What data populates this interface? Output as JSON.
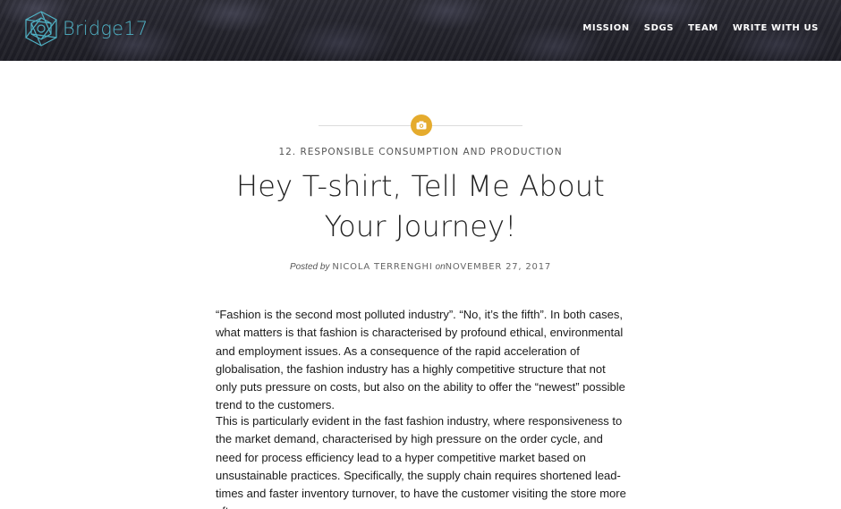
{
  "header": {
    "logo_text": "Bridge17",
    "nav": [
      {
        "label": "MISSION"
      },
      {
        "label": "SDGS"
      },
      {
        "label": "TEAM"
      },
      {
        "label": "WRITE WITH US"
      }
    ]
  },
  "post": {
    "format_icon": "camera-icon",
    "category": "12. RESPONSIBLE CONSUMPTION AND PRODUCTION",
    "title_line1": "Hey T-shirt, Tell Me About",
    "title_line2": "Your Journey!",
    "posted_by_label": "Posted by",
    "author": "NICOLA TERRENGHI",
    "on_label": "on",
    "date": "NOVEMBER 27, 2017",
    "paragraphs": [
      "“Fashion is the second most polluted industry”. “No, it’s the fifth”. In both cases, what matters is that fashion is characterised by profound ethical, environmental and employment issues. As a consequence of the rapid acceleration of globalisation, the fashion industry has a highly competitive structure that not only puts pressure on costs, but also on the ability to offer the “newest” possible trend to the customers.",
      "This is particularly evident in the fast fashion industry, where responsiveness to the market demand, characterised by high pressure on the order cycle, and need for process efficiency lead to a hyper competitive market based on unsustainable practices. Specifically, the supply chain requires shortened lead-times and faster inventory turnover, to have the customer visiting the store more often."
    ]
  },
  "colors": {
    "accent": "#e5ab2d",
    "logo": "#4fb1c4",
    "header_bg": "#23232b"
  }
}
